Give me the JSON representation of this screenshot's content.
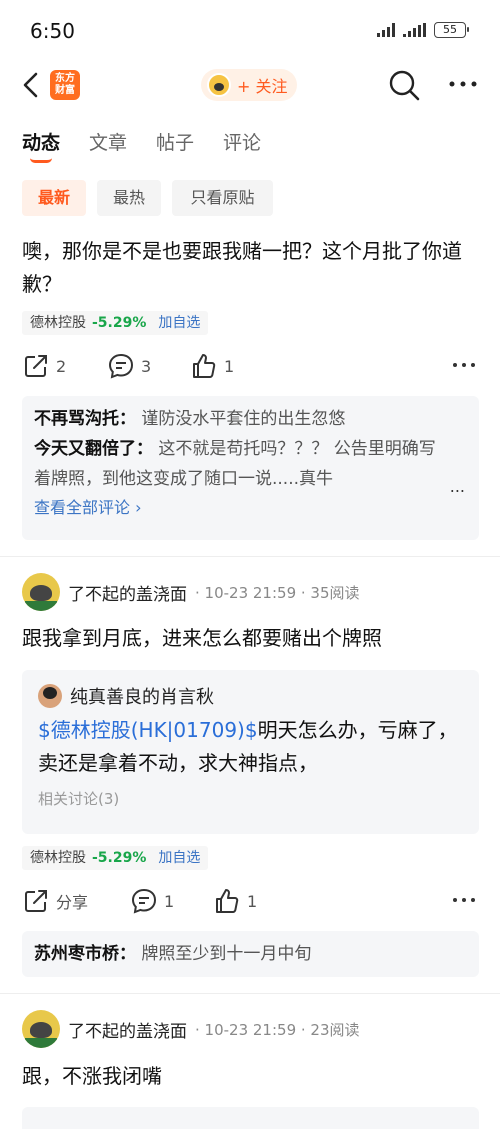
{
  "status": {
    "time": "6:50",
    "battery": "55"
  },
  "nav": {
    "logo_line1": "东方",
    "logo_line2": "财富",
    "follow_label": "+ 关注"
  },
  "tabs": [
    "动态",
    "文章",
    "帖子",
    "评论"
  ],
  "filters": [
    "最新",
    "最热",
    "只看原贴"
  ],
  "post1": {
    "text": "噢，那你是不是也要跟我赌一把？这个月批了你道歉？",
    "stock": {
      "name": "德林控股",
      "change": "-5.29%",
      "add": "加自选"
    },
    "actions": {
      "share": "2",
      "comment": "3",
      "like": "1"
    },
    "comments": [
      {
        "author": "不再骂沟托：",
        "text": "谨防没水平套住的出生忽悠"
      },
      {
        "author": "今天又翻倍了：",
        "text": "这不就是苟托吗？？？ 公告里明确写着牌照，到他这变成了随口一说.....真牛"
      }
    ],
    "more_dots": "...",
    "view_all": "查看全部评论 ›"
  },
  "post2": {
    "author": "了不起的盖浇面",
    "meta": "· 10-23 21:59 · 35阅读",
    "text": "跟我拿到月底，进来怎么都要赌出个牌照",
    "quote": {
      "author": "纯真善良的肖言秋",
      "link": "$德林控股(HK|01709)$",
      "text": "明天怎么办，亏麻了，卖还是拿着不动，求大神指点，",
      "related": "相关讨论(3)"
    },
    "stock": {
      "name": "德林控股",
      "change": "-5.29%",
      "add": "加自选"
    },
    "actions": {
      "share": "分享",
      "comment": "1",
      "like": "1"
    },
    "comments": [
      {
        "author": "苏州枣市桥：",
        "text": "牌照至少到十一月中旬"
      }
    ]
  },
  "post3": {
    "author": "了不起的盖浇面",
    "meta": "· 10-23 21:59 · 23阅读",
    "text": "跟，不涨我闭嘴"
  }
}
